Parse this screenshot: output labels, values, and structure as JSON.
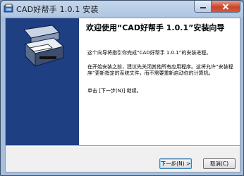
{
  "window": {
    "title": "CAD好帮手 1.0.1 安装",
    "controls": {
      "minimize": "minimize-icon",
      "close": "close-icon"
    },
    "colors": {
      "banner": "#1f3f83",
      "close": "#c9452a"
    }
  },
  "banner": {
    "logo": "cad-plotter-logo-icon"
  },
  "content": {
    "heading": "欢迎使用“CAD好帮手 1.0.1”安装向导",
    "paragraph1": "这个向导将指引你完成“CAD好帮手 1.0.1”的安装进程。",
    "paragraph2": "在开始安装之前，建议先关闭其他所有应用程序。这将允许“安装程序”更新指定的系统文件，而不需要重新启动你的计算机。",
    "paragraph3": "单击 [下一步(N)] 继续。"
  },
  "buttons": {
    "next": "下一步(N) >",
    "cancel": "取消(C)"
  }
}
